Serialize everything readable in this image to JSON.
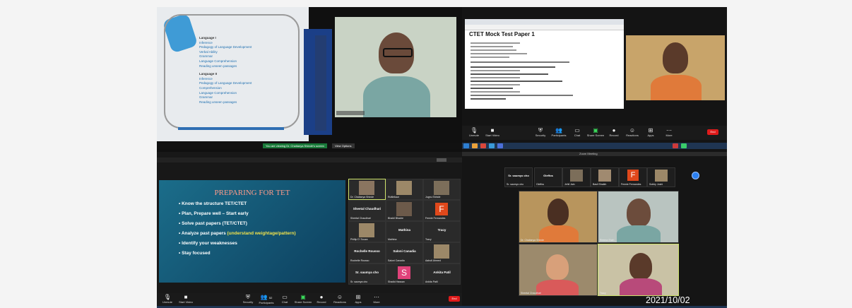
{
  "meeting_title": "Zoom Meeting",
  "date_stamp": "2021/10/02",
  "slide1": {
    "heading1": "Language I",
    "items1": [
      "Inference",
      "Pedagogy of Language Development",
      "Verbal Ability",
      "Grammar",
      "Language Comprehension",
      "Reading unseen passages"
    ],
    "heading2": "Language II",
    "items2": [
      "Inference",
      "Pedagogy of Language Development",
      "Comprehension",
      "Language Comprehension",
      "Grammar",
      "Reading unseen passages"
    ]
  },
  "share_bar": {
    "status": "You are viewing Dr. Chaitanya Shindé's screen",
    "view_options": "View Options"
  },
  "mock_test": {
    "title": "CTET Mock Test Paper 1"
  },
  "toolbar": {
    "mute": "Unmute",
    "video": "Start Video",
    "security": "Security",
    "participants": "Participants",
    "participants_count": "52",
    "chat": "Chat",
    "share": "Share Screen",
    "record": "Record",
    "reactions": "Reactions",
    "apps": "Apps",
    "more": "More",
    "end": "End"
  },
  "tet_slide": {
    "title": "PREPARING FOR TET",
    "bullets": [
      {
        "text": "Know the structure TET/CTET",
        "highlight": ""
      },
      {
        "text": "Plan, Prepare well – Start early",
        "highlight": ""
      },
      {
        "text": "Solve past papers (TET/CTET)",
        "highlight": ""
      },
      {
        "text": "Analyze past papers ",
        "highlight": "(understand weightage/pattern)"
      },
      {
        "text": "Identify your weaknesses",
        "highlight": ""
      },
      {
        "text": "Stay focused",
        "highlight": ""
      }
    ]
  },
  "gallery_q3": {
    "tiles": [
      {
        "name": "Dr. Chaitanya Shinde",
        "initial": "",
        "kind": "photo"
      },
      {
        "name": "Ruttiekaur",
        "initial": "",
        "kind": "photo"
      },
      {
        "name": "Jugnu Shinde",
        "initial": "",
        "kind": "photo"
      },
      {
        "name": "Sheetal Chaudhari",
        "initial": "",
        "kind": "name"
      },
      {
        "name": "Bhakti Bhadre",
        "initial": "",
        "kind": "photo"
      },
      {
        "name": "Fennie Fernandes",
        "initial": "F",
        "kind": "letter"
      },
      {
        "name": "Phillip D' Souza",
        "initial": "",
        "kind": "photo"
      },
      {
        "name": "Mathina",
        "initial": "",
        "kind": "name"
      },
      {
        "name": "Tracy",
        "initial": "",
        "kind": "name"
      },
      {
        "name": "Rochelle Rousso",
        "initial": "",
        "kind": "name"
      },
      {
        "name": "Saloni Canadia",
        "initial": "",
        "kind": "name"
      },
      {
        "name": "Aahuti Ahmed",
        "initial": "",
        "kind": "photo"
      },
      {
        "name": "Sr. saumya cho",
        "initial": "",
        "kind": "name"
      },
      {
        "name": "Shadid Hassan",
        "initial": "S",
        "kind": "letter"
      },
      {
        "name": "Ankita Patil",
        "initial": "",
        "kind": "name"
      }
    ]
  },
  "gallery_q4_top": [
    {
      "name": "Sr. saumyo cho",
      "initial": "",
      "kind": "name"
    },
    {
      "name": "Gleffos",
      "initial": "",
      "kind": "name"
    },
    {
      "name": "Jehil Jain",
      "initial": "",
      "kind": "photo"
    },
    {
      "name": "Basil Shaikh",
      "initial": "",
      "kind": "photo"
    },
    {
      "name": "Fennie Fernandes",
      "initial": "F",
      "kind": "letter"
    },
    {
      "name": "Sobby Joshi",
      "initial": "",
      "kind": "photo"
    }
  ],
  "gallery_q4_main": [
    {
      "name": "Dr. Chaitanya Shinde"
    },
    {
      "name": "Reema Shah"
    },
    {
      "name": "Sheetal Chaudhari"
    },
    {
      "name": "Tracy"
    }
  ],
  "colors": {
    "accent": "#27a7f3",
    "end_red": "#e01b1b",
    "slide_teal": "#1b6d8a",
    "highlight_yellow": "#f0e24c"
  }
}
